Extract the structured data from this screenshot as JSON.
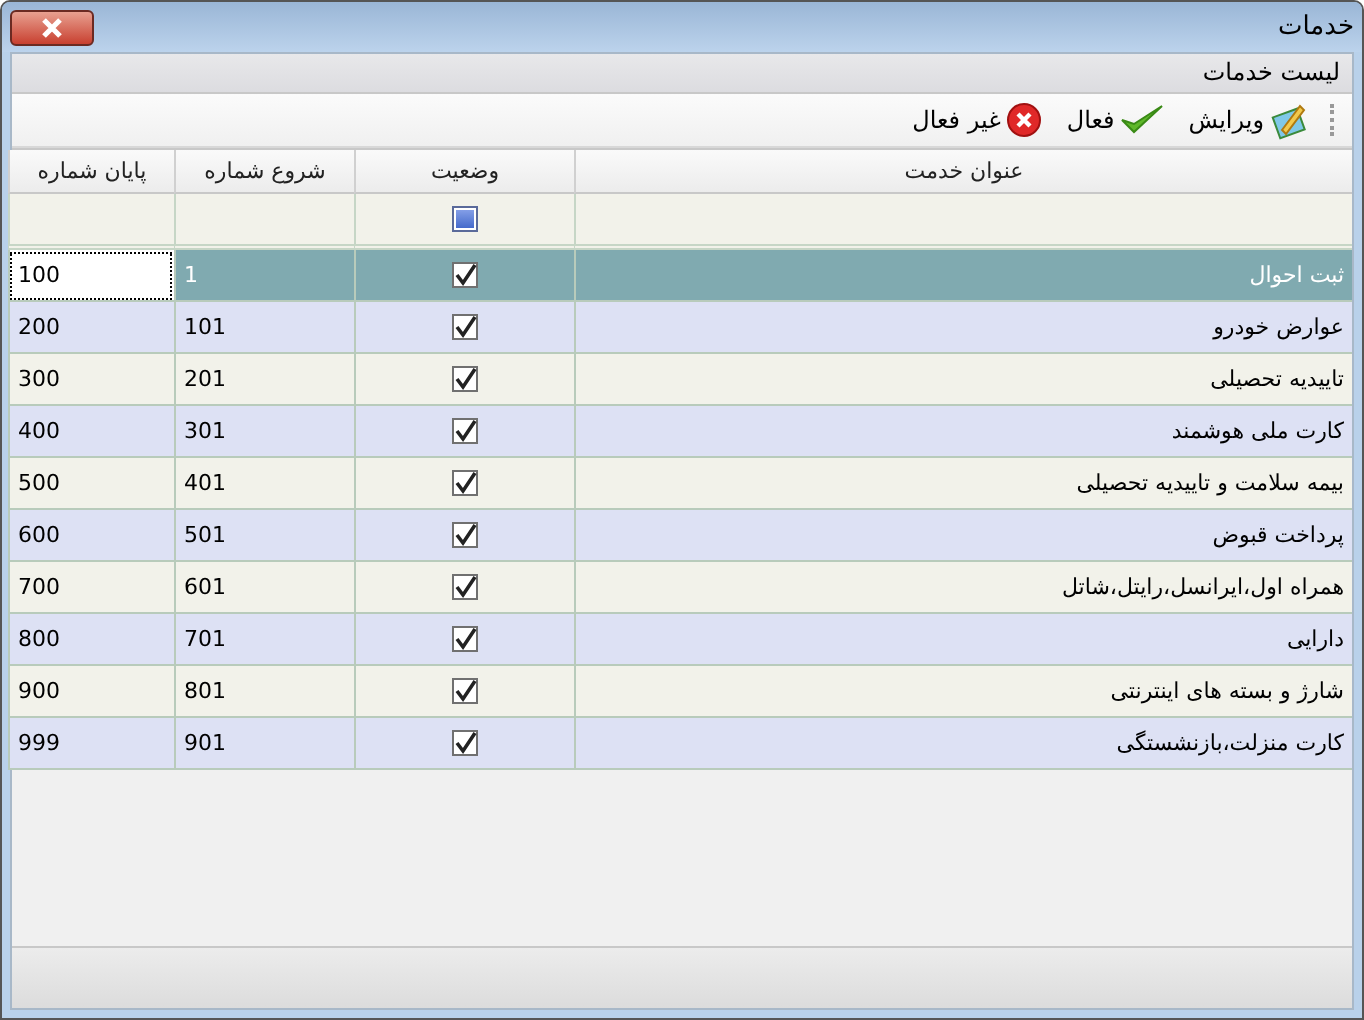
{
  "window": {
    "title": "خدمات"
  },
  "caption": "لیست خدمات",
  "toolbar": [
    {
      "kind": "edit",
      "label": "ویرایش"
    },
    {
      "kind": "activate",
      "label": "فعال"
    },
    {
      "kind": "deactivate",
      "label": "غیر فعال"
    }
  ],
  "table": {
    "filter_checkbox": {
      "indeterminate": true
    },
    "columns": [
      "عنوان خدمت",
      "وضعیت",
      "شروع شماره",
      "پایان شماره"
    ],
    "rows": [
      {
        "title": "ثبت احوال",
        "active": true,
        "start": "1",
        "end": "100",
        "selected": true
      },
      {
        "title": "عوارض خودرو",
        "active": true,
        "start": "101",
        "end": "200",
        "selected": false
      },
      {
        "title": "تاییدیه تحصیلی",
        "active": true,
        "start": "201",
        "end": "300",
        "selected": false
      },
      {
        "title": "کارت ملی هوشمند",
        "active": true,
        "start": "301",
        "end": "400",
        "selected": false
      },
      {
        "title": "بیمه سلامت و تاییدیه تحصیلی",
        "active": true,
        "start": "401",
        "end": "500",
        "selected": false
      },
      {
        "title": "پرداخت قبوض",
        "active": true,
        "start": "501",
        "end": "600",
        "selected": false
      },
      {
        "title": "همراه اول،ایرانسل،رایتل،شاتل",
        "active": true,
        "start": "601",
        "end": "700",
        "selected": false
      },
      {
        "title": "دارایی",
        "active": true,
        "start": "701",
        "end": "800",
        "selected": false
      },
      {
        "title": "شارژ و بسته های اینترنتی",
        "active": true,
        "start": "801",
        "end": "900",
        "selected": false
      },
      {
        "title": "کارت منزلت،بازنشستگی",
        "active": true,
        "start": "901",
        "end": "999",
        "selected": false
      }
    ]
  }
}
